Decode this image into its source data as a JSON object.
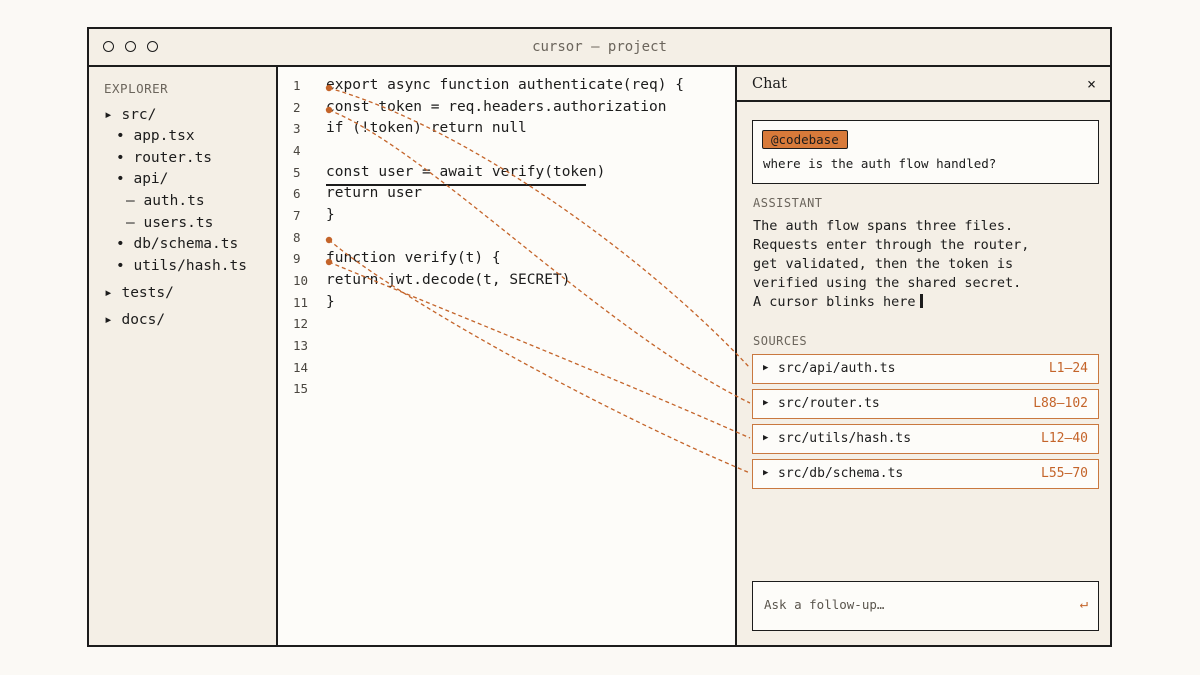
{
  "window": {
    "title": "cursor — project"
  },
  "sidebar": {
    "heading": "EXPLORER",
    "items": [
      {
        "label": "▸ src/"
      },
      {
        "label": "• app.tsx"
      },
      {
        "label": "• router.ts"
      },
      {
        "label": "• api/"
      },
      {
        "label": "— auth.ts"
      },
      {
        "label": "— users.ts"
      },
      {
        "label": "• db/schema.ts"
      },
      {
        "label": "• utils/hash.ts"
      },
      {
        "label": "▸ tests/"
      },
      {
        "label": "▸ docs/"
      }
    ]
  },
  "editor": {
    "line_numbers": [
      "1",
      "2",
      "3",
      "4",
      "5",
      "6",
      "7",
      "8",
      "9",
      "10",
      "11",
      "12",
      "13",
      "14",
      "15"
    ],
    "lines": [
      "export async function authenticate(req) {",
      "const token = req.headers.authorization",
      "if (!token) return null",
      "",
      "const user = await verify(token)",
      "return user",
      "}",
      "",
      "function verify(t) {",
      "return jwt.decode(t, SECRET)",
      "}",
      "",
      "",
      "",
      ""
    ]
  },
  "chat": {
    "title": "Chat",
    "close": "×",
    "query": {
      "tag": "@codebase",
      "text": "where is the auth flow handled?"
    },
    "assistant_label": "ASSISTANT",
    "answer_lines": [
      "The auth flow spans three files.",
      "Requests enter through the router,",
      "get validated, then the token is",
      "verified using the shared secret.",
      "A cursor blinks here"
    ],
    "sources_label": "SOURCES",
    "sources": [
      {
        "path": "src/api/auth.ts",
        "range": "L1–24"
      },
      {
        "path": "src/router.ts",
        "range": "L88–102"
      },
      {
        "path": "src/utils/hash.ts",
        "range": "L12–40"
      },
      {
        "path": "src/db/schema.ts",
        "range": "L55–70"
      }
    ],
    "followup_placeholder": "Ask a follow-up…",
    "enter_icon": "↵"
  },
  "colors": {
    "accent": "#d87a3a",
    "link": "#c4642a",
    "ink": "#1c1c1c",
    "panel": "#f4efe6"
  }
}
